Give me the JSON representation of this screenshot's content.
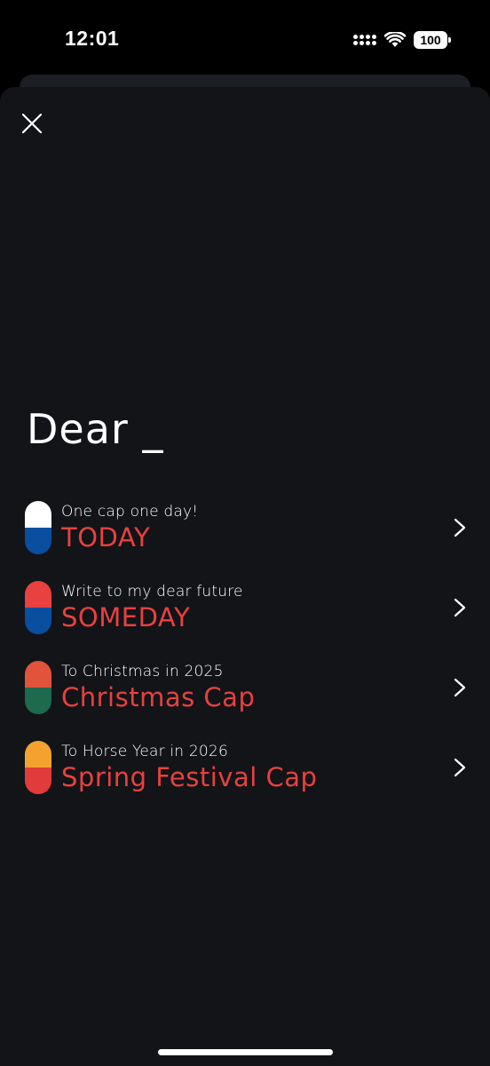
{
  "status_bar": {
    "time": "12:01",
    "battery": "100",
    "icons": [
      "signal-icon",
      "wifi-icon",
      "battery-icon"
    ]
  },
  "header": {
    "close_icon": "close-icon",
    "title": "Dear _"
  },
  "caps": [
    {
      "subtitle": "One cap one day!",
      "title": "TODAY",
      "top_color": "#ffffff",
      "bottom_color": "#0a4ea0"
    },
    {
      "subtitle": "Write to my dear future",
      "title": "SOMEDAY",
      "top_color": "#e8413f",
      "bottom_color": "#0a4ea0"
    },
    {
      "subtitle": "To Christmas in 2025",
      "title": "Christmas Cap",
      "top_color": "#e1533b",
      "bottom_color": "#1e6a4f"
    },
    {
      "subtitle": "To Horse Year in 2026",
      "title": "Spring Festival Cap",
      "top_color": "#f3a22f",
      "bottom_color": "#e23b3b"
    }
  ],
  "colors": {
    "background": "#121418",
    "accent": "#e8413f",
    "text": "#ffffff"
  }
}
